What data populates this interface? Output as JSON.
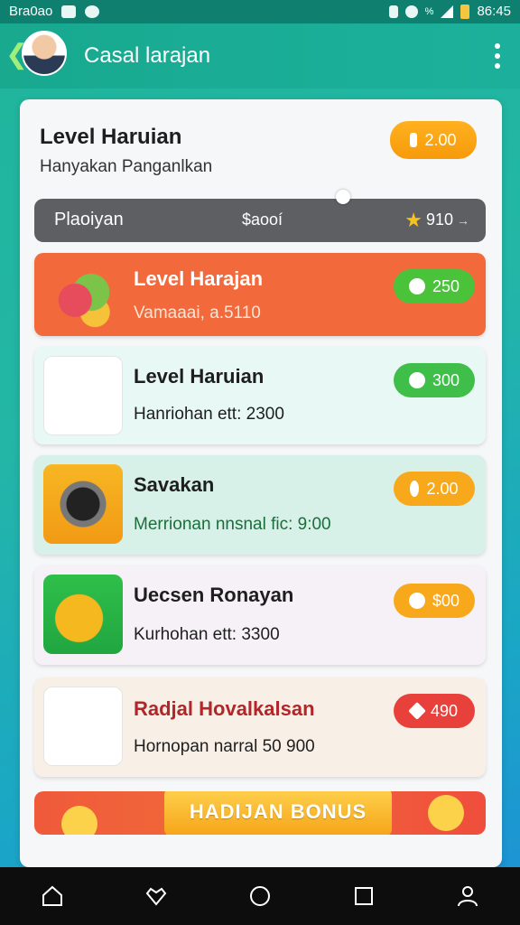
{
  "status_bar": {
    "carrier": "Bra0ao",
    "time": "86:45",
    "signal_label": "%"
  },
  "app_bar": {
    "title": "Casal larajan"
  },
  "header": {
    "title": "Level Haruian",
    "subtitle": "Hanyakan Panganlkan",
    "points": "2.00"
  },
  "progress": {
    "label": "Plaoiyan",
    "coins": "$aooí",
    "stars": "910"
  },
  "items": [
    {
      "title": "Level Harajan",
      "subtitle": "Vamaaai, a.5110",
      "badge": "250",
      "badge_color": "#4ac33b",
      "bg": "#f26a3c"
    },
    {
      "title": "Level Haruian",
      "subtitle": "Hanriohan ett: 2300",
      "badge": "300",
      "badge_color": "#3fbf4a",
      "bg": "#e7f8f5"
    },
    {
      "title": "Savakan",
      "subtitle": "Merrionan nnsnal fic: 9:00",
      "badge": "2.00",
      "badge_color": "#f7a81b",
      "bg": "#d7f0e8"
    },
    {
      "title": "Uecsen Ronayan",
      "subtitle": "Kurhohan ett: 3300",
      "badge": "$00",
      "badge_color": "#f7a81b",
      "bg": "#f5f1f6"
    },
    {
      "title": "Radjal Hovalkalsan",
      "subtitle": "Hornopan narral 50 900",
      "badge": "490",
      "badge_color": "#e8413b",
      "bg": "#f8f0e6"
    }
  ],
  "bonus": {
    "label": "HADIJAN BONUS"
  },
  "nav": [
    "home-icon",
    "heart-icon",
    "circle-icon",
    "square-icon",
    "profile-icon"
  ]
}
